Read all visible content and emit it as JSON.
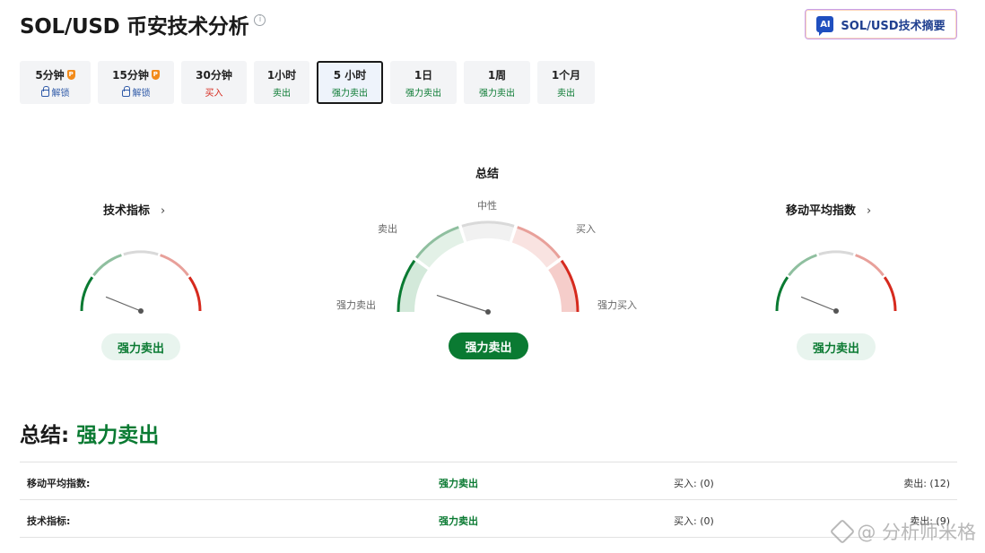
{
  "header": {
    "title": "SOL/USD 币安技术分析",
    "ai_button": {
      "badge": "AI",
      "label": "SOL/USD技术摘要"
    }
  },
  "tabs": [
    {
      "name": "5分钟",
      "sub": "解锁",
      "pro": true,
      "locked": true
    },
    {
      "name": "15分钟",
      "sub": "解锁",
      "pro": true,
      "locked": true
    },
    {
      "name": "30分钟",
      "sub": "买入"
    },
    {
      "name": "1小时",
      "sub": "卖出"
    },
    {
      "name": "5 小时",
      "sub": "强力卖出",
      "active": true
    },
    {
      "name": "1日",
      "sub": "强力卖出"
    },
    {
      "name": "1周",
      "sub": "强力卖出"
    },
    {
      "name": "1个月",
      "sub": "卖出"
    }
  ],
  "gauges": {
    "technical": {
      "title": "技术指标",
      "result": "强力卖出"
    },
    "summary": {
      "title": "总结",
      "result": "强力卖出",
      "labels": {
        "strong_sell": "强力卖出",
        "sell": "卖出",
        "neutral": "中性",
        "buy": "买入",
        "strong_buy": "强力买入"
      }
    },
    "moving_avg": {
      "title": "移动平均指数",
      "result": "强力卖出"
    }
  },
  "summary": {
    "heading": "总结:",
    "value": "强力卖出",
    "rows": [
      {
        "name": "移动平均指数:",
        "signal": "强力卖出",
        "buy": "买入: (0)",
        "sell": "卖出: (12)"
      },
      {
        "name": "技术指标:",
        "signal": "强力卖出",
        "buy": "买入: (0)",
        "sell": "卖出: (9)"
      }
    ]
  },
  "watermark": "@ 分析师米格",
  "colors": {
    "strong_sell": "#0a7a32",
    "sell": "#8fbf9f",
    "neutral": "#d9d9d9",
    "buy": "#e8a09a",
    "strong_buy": "#d62a1e"
  }
}
